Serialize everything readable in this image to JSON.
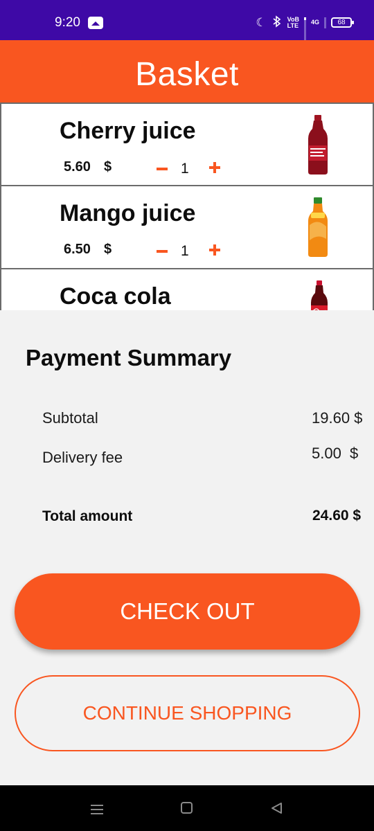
{
  "status_bar": {
    "time": "9:20",
    "network_label": "4G",
    "lte_label": "LTE",
    "volte_label": "VoB",
    "battery": "68"
  },
  "header": {
    "title": "Basket"
  },
  "basket": {
    "items": [
      {
        "name": "Cherry juice",
        "price": "5.60",
        "currency": "$",
        "quantity": "1",
        "image_icon": "cherry-juice-bottle",
        "color": "#8b0f1c"
      },
      {
        "name": "Mango juice",
        "price": "6.50",
        "currency": "$",
        "quantity": "1",
        "image_icon": "mango-juice-bottle",
        "color": "#f28a12"
      },
      {
        "name": "Coca cola",
        "price": "",
        "currency": "",
        "quantity": "",
        "image_icon": "coca-cola-bottle",
        "color": "#7a0a0f"
      }
    ]
  },
  "summary": {
    "title": "Payment Summary",
    "subtotal_label": "Subtotal",
    "subtotal_value": "19.60 $",
    "delivery_label": "Delivery fee",
    "delivery_value": "5.00  $",
    "total_label": "Total amount",
    "total_value": "24.60 $"
  },
  "actions": {
    "checkout_label": "CHECK OUT",
    "continue_label": "CONTINUE SHOPPING"
  },
  "colors": {
    "accent": "#f95620",
    "status_bar": "#3e09a6"
  }
}
